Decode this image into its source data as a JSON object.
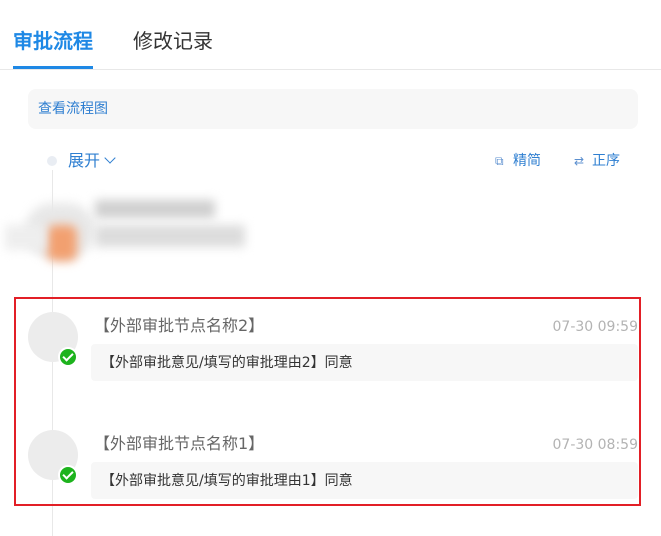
{
  "tabs": [
    {
      "label": "审批流程",
      "active": true
    },
    {
      "label": "修改记录",
      "active": false
    }
  ],
  "flow": {
    "link_label": "查看流程图"
  },
  "controls": {
    "expand_label": "展开",
    "brief_label": "精简",
    "order_label": "正序"
  },
  "icons": {
    "brief": "compact-view-icon",
    "order": "swap-order-icon",
    "status": "approved-check-icon"
  },
  "records": [
    {
      "node_name": "【外部审批节点名称2】",
      "time": "07-30 09:59",
      "comment": "【外部审批意见/填写的审批理由2】同意",
      "status": "approved"
    },
    {
      "node_name": "【外部审批节点名称1】",
      "time": "07-30 08:59",
      "comment": "【外部审批意见/填写的审批理由1】同意",
      "status": "approved"
    }
  ],
  "colors": {
    "accent": "#1e88e5",
    "link": "#2f7fd1",
    "approved": "#1db31d",
    "highlight_border": "#e21f26"
  }
}
